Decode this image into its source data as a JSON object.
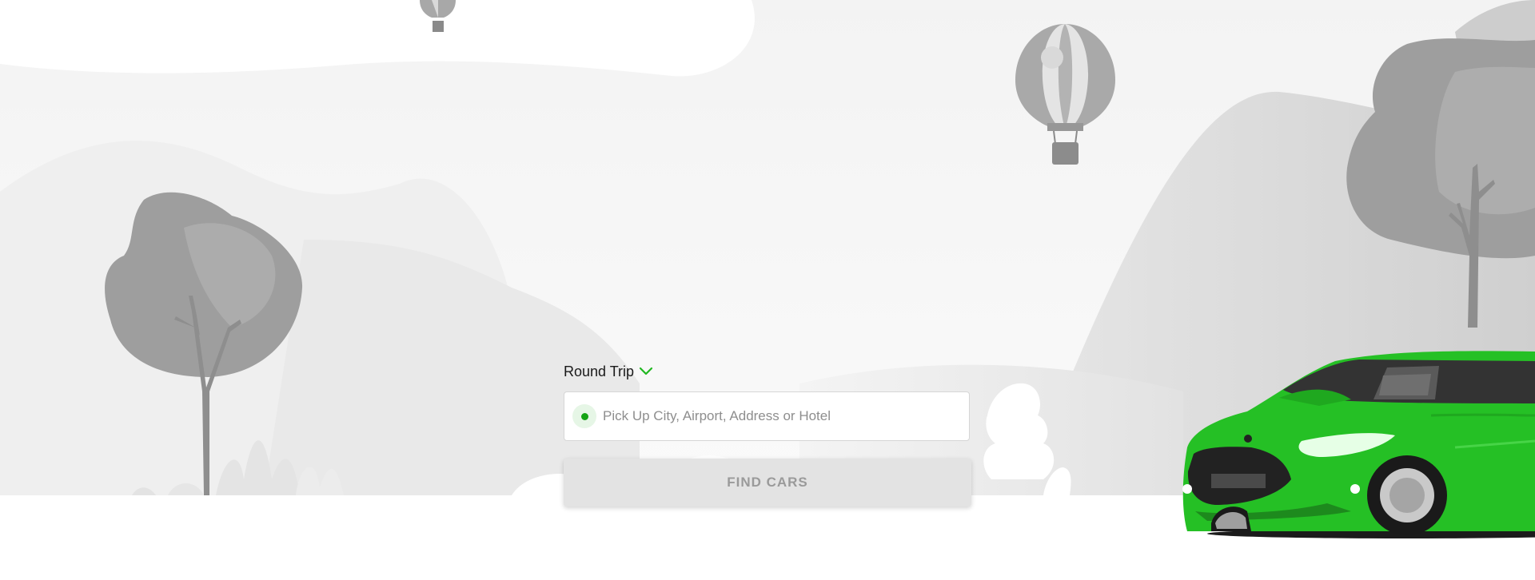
{
  "search": {
    "trip_type": "Round Trip",
    "pickup_placeholder": "Pick Up City, Airport, Address or Hotel",
    "pickup_value": "",
    "find_button_label": "FIND CARS"
  },
  "icons": {
    "trip_dropdown": "chevron-down-icon",
    "pickup_marker": "location-dot-icon"
  },
  "colors": {
    "accent": "#22b822",
    "button_bg": "#e3e3e3",
    "button_text": "#9a9a9a",
    "scene_gray": "#9b9b9b"
  }
}
